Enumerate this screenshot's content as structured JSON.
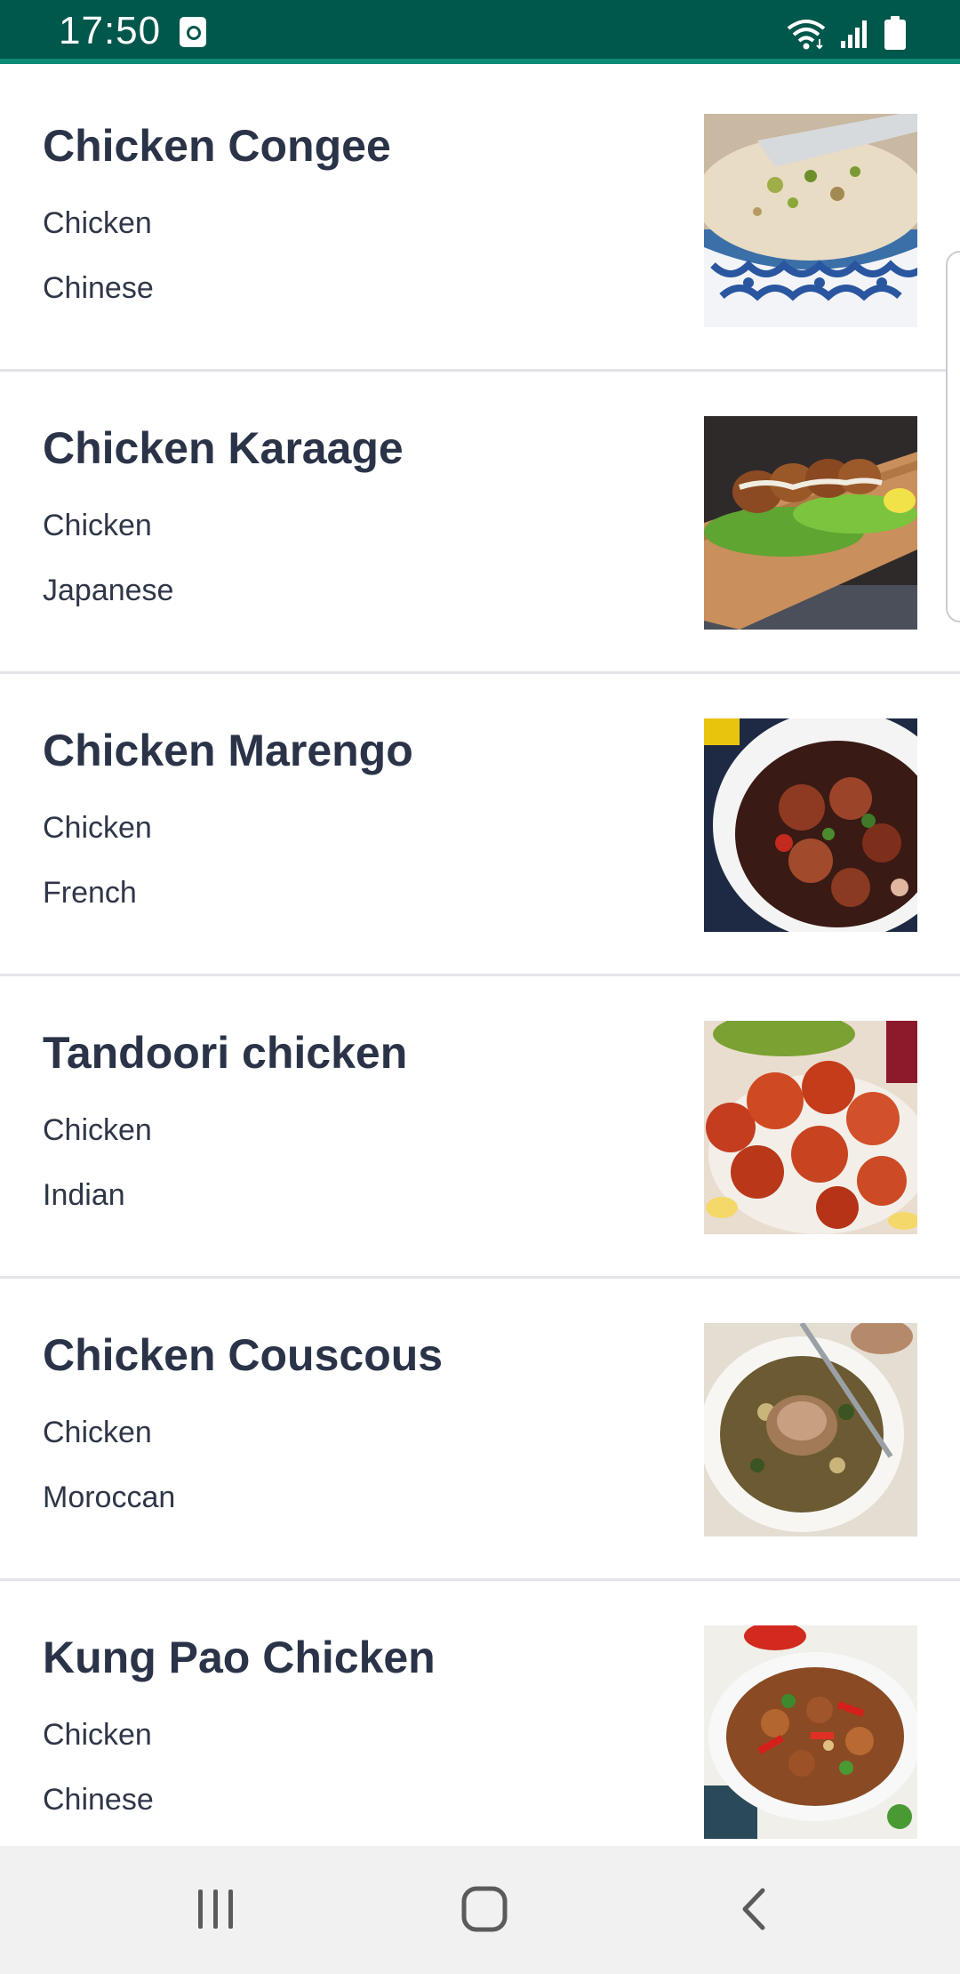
{
  "status_bar": {
    "time": "17:50",
    "icons": [
      "notification-icon",
      "wifi-icon",
      "signal-icon",
      "battery-icon"
    ],
    "background": "#00574b"
  },
  "recipes": [
    {
      "name": "Chicken Congee",
      "category": "Chicken",
      "area": "Chinese",
      "thumb_icon": "congee-photo"
    },
    {
      "name": "Chicken Karaage",
      "category": "Chicken",
      "area": "Japanese",
      "thumb_icon": "karaage-photo"
    },
    {
      "name": "Chicken Marengo",
      "category": "Chicken",
      "area": "French",
      "thumb_icon": "marengo-photo"
    },
    {
      "name": "Tandoori chicken",
      "category": "Chicken",
      "area": "Indian",
      "thumb_icon": "tandoori-photo"
    },
    {
      "name": "Chicken Couscous",
      "category": "Chicken",
      "area": "Moroccan",
      "thumb_icon": "couscous-photo"
    },
    {
      "name": "Kung Pao Chicken",
      "category": "Chicken",
      "area": "Chinese",
      "thumb_icon": "kung-pao-photo"
    }
  ],
  "nav_bar": {
    "buttons": [
      "recent-apps-icon",
      "home-icon",
      "back-icon"
    ]
  },
  "colors": {
    "title_text": "#2a3348",
    "body_text": "#2f3648",
    "divider": "#e3e4e8"
  }
}
